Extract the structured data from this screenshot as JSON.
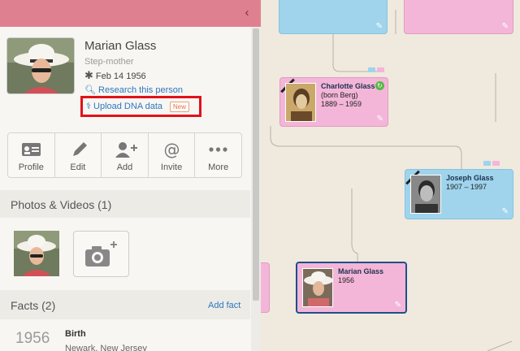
{
  "person": {
    "name": "Marian Glass",
    "relation": "Step-mother",
    "birth": "Feb 14 1956",
    "research_link": "Research this person",
    "dna_link": "Upload DNA data",
    "new_badge": "New"
  },
  "actions": [
    {
      "label": "Profile",
      "icon": "profile-card-icon"
    },
    {
      "label": "Edit",
      "icon": "pencil-icon"
    },
    {
      "label": "Add",
      "icon": "add-person-icon"
    },
    {
      "label": "Invite",
      "icon": "at-icon"
    },
    {
      "label": "More",
      "icon": "more-dots-icon"
    }
  ],
  "photos": {
    "title": "Photos & Videos (1)"
  },
  "facts": {
    "title": "Facts (2)",
    "add_label": "Add fact",
    "items": [
      {
        "year": "1956",
        "type": "Birth",
        "place": "Newark, New Jersey"
      }
    ]
  },
  "tree": {
    "cards": [
      {
        "name": "Charlotte Glass",
        "note": "(born Berg)",
        "years": "1889 – 1959",
        "gender": "female"
      },
      {
        "name": "Joseph Glass",
        "years": "1907 – 1997",
        "gender": "male"
      },
      {
        "name": "Marian Glass",
        "years": "1956",
        "gender": "female"
      }
    ]
  },
  "colors": {
    "topbar": "#df8090",
    "female_card": "#f3b6d8",
    "male_card": "#9fd4ec",
    "link": "#2e77c0",
    "highlight": "#e0121b"
  }
}
